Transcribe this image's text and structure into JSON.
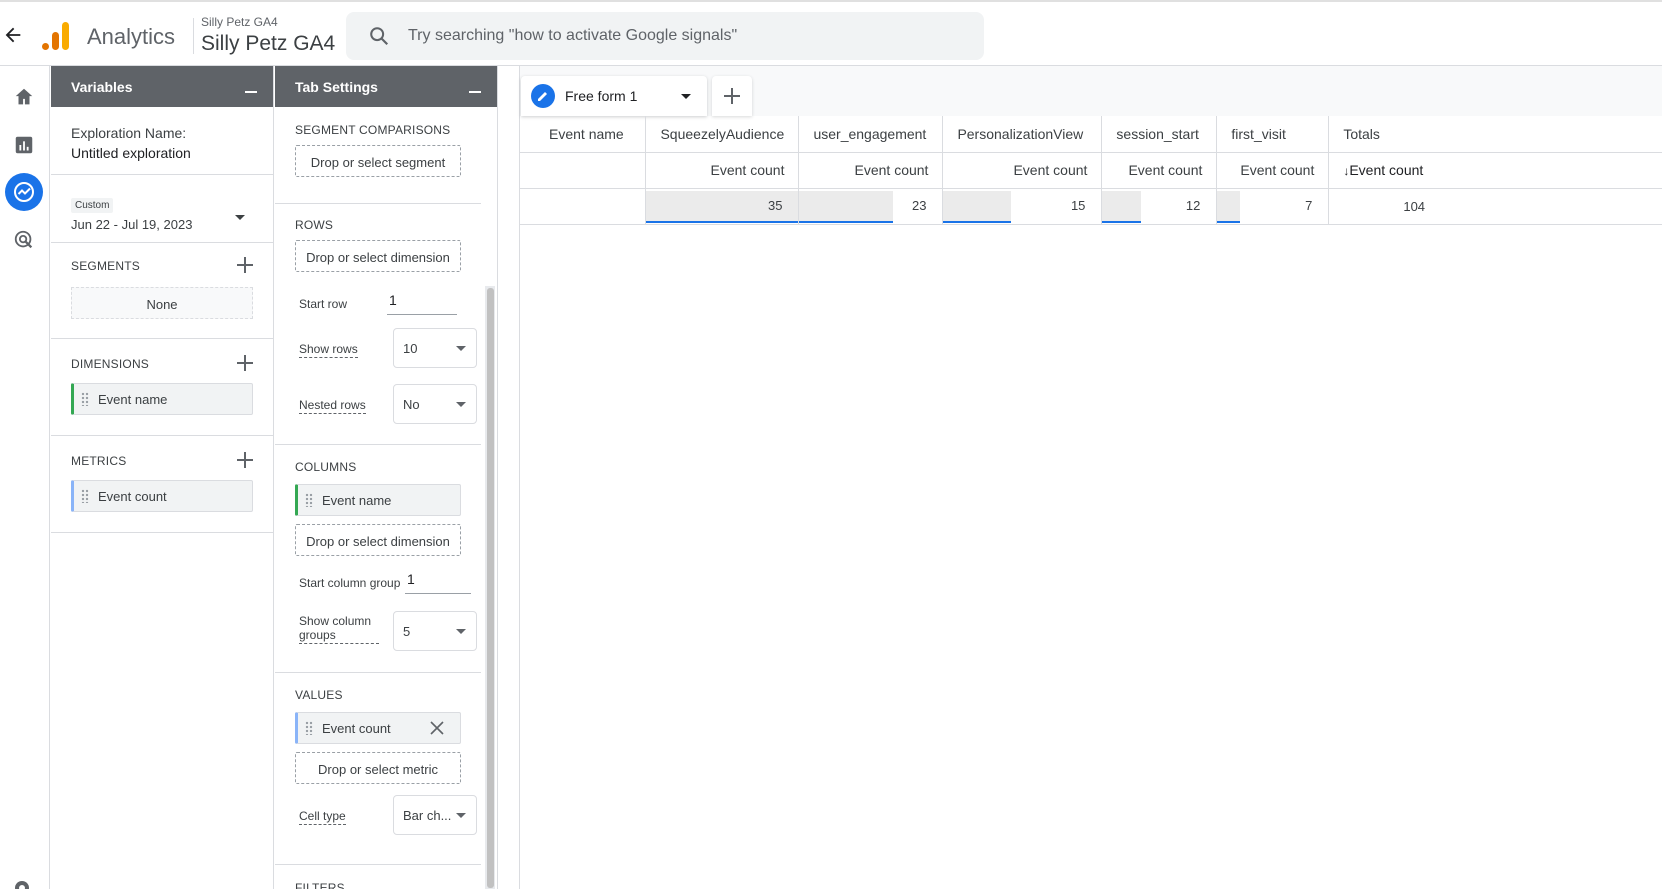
{
  "header": {
    "brand": "Analytics",
    "property_small": "Silly Petz GA4",
    "property_big": "Silly Petz GA4",
    "search_placeholder": "Try searching \"how to activate Google signals\""
  },
  "colors": {
    "accent": "#1a73e8",
    "panel_header": "#5f6368",
    "dimension_chip": "#34a853",
    "metric_chip": "#8ab4f8"
  },
  "icons": [
    "back-arrow-icon",
    "analytics-logo-icon",
    "search-icon",
    "home-icon",
    "reports-icon",
    "explore-icon",
    "advertising-icon",
    "settings-icon",
    "pencil-icon",
    "plus-icon",
    "close-icon",
    "chevron-down-icon"
  ],
  "variables": {
    "title": "Variables",
    "exploration_label": "Exploration Name:",
    "exploration_value": "Untitled exploration",
    "date_tag": "Custom",
    "date_range": "Jun 22 - Jul 19, 2023",
    "segments_title": "SEGMENTS",
    "segments_value": "None",
    "dimensions_title": "DIMENSIONS",
    "dimensions": [
      "Event name"
    ],
    "metrics_title": "METRICS",
    "metrics": [
      "Event count"
    ]
  },
  "tab_settings": {
    "title": "Tab Settings",
    "segment_comparisons_title": "SEGMENT COMPARISONS",
    "segment_drop": "Drop or select segment",
    "rows_title": "ROWS",
    "rows_drop": "Drop or select dimension",
    "start_row_label": "Start row",
    "start_row_value": "1",
    "show_rows_label": "Show rows",
    "show_rows_value": "10",
    "nested_rows_label": "Nested rows",
    "nested_rows_value": "No",
    "columns_title": "COLUMNS",
    "columns_chip": "Event name",
    "columns_drop": "Drop or select dimension",
    "start_col_label": "Start column group",
    "start_col_value": "1",
    "show_col_label": "Show column groups",
    "show_col_value": "5",
    "values_title": "VALUES",
    "values_chip": "Event count",
    "values_drop": "Drop or select metric",
    "cell_type_label": "Cell type",
    "cell_type_value": "Bar ch...",
    "filters_title": "FILTERS"
  },
  "canvas": {
    "tab_label": "Free form 1",
    "dimension_header": "Event name",
    "columns": [
      "SqueezelyAudience",
      "user_engagement",
      "PersonalizationView",
      "session_start",
      "first_visit",
      "Totals"
    ],
    "metric_label": "Event count",
    "totals_metric_label": "Event count",
    "values": [
      35,
      23,
      15,
      12,
      7
    ],
    "total": 104
  }
}
